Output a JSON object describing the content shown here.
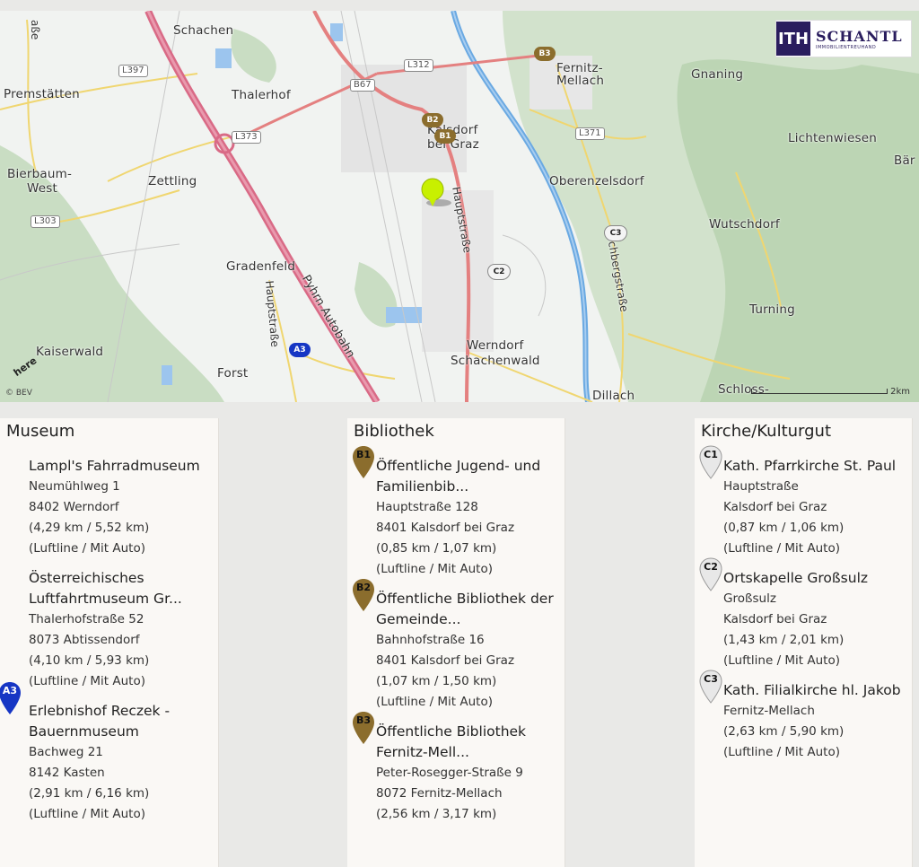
{
  "map": {
    "places": [
      {
        "name": "Schachen"
      },
      {
        "name": "Premstätten"
      },
      {
        "name": "Thalerhof"
      },
      {
        "name": "Fernitz-"
      },
      {
        "name": "Mellach"
      },
      {
        "name": "Gnaning"
      },
      {
        "name": "Kalsdorf"
      },
      {
        "name": "bei Graz"
      },
      {
        "name": "Lichtenwiesen"
      },
      {
        "name": "Bär"
      },
      {
        "name": "Bierbaum-"
      },
      {
        "name": "West"
      },
      {
        "name": "Zettling"
      },
      {
        "name": "Oberenzelsdorf"
      },
      {
        "name": "Wutschdorf"
      },
      {
        "name": "Gradenfeld"
      },
      {
        "name": "Turning"
      },
      {
        "name": "Kaiserwald"
      },
      {
        "name": "Werndorf"
      },
      {
        "name": "Schachenwald"
      },
      {
        "name": "Forst"
      },
      {
        "name": "Dillach"
      },
      {
        "name": "Schloss-"
      }
    ],
    "roads": [
      "L397",
      "L312",
      "B67",
      "L373",
      "L371",
      "L303"
    ],
    "streets": [
      "Hauptstraße",
      "Hauptstraße",
      "Pyhrn Autobahn",
      "Kirchbergstraße",
      "aße"
    ],
    "markers": [
      "B3",
      "B2",
      "B1",
      "C3",
      "C2",
      "A3"
    ],
    "attribution": "© BEV",
    "here": "here",
    "scale": "2km",
    "colors": {
      "autobahn": "#d96a86",
      "main_road": "#e48080",
      "river": "#6aa9e2",
      "forest": "#c9ddc3",
      "marker_b": "#8b6d2d",
      "marker_a": "#1636c4",
      "marker_c": "#e8e8e8",
      "target": "#c8f000"
    }
  },
  "logo": {
    "mark": "ITH",
    "name": "SCHANTL",
    "sub": "IMMOBILIENTREUHAND"
  },
  "columns": [
    {
      "title": "Museum",
      "entries": [
        {
          "marker": "",
          "name": "Lampl's Fahrradmuseum",
          "name2": "",
          "lines": [
            "Neumühlweg 1",
            "8402 Werndorf",
            "(4,29 km / 5,52 km)",
            "(Luftline / Mit Auto)"
          ]
        },
        {
          "marker": "",
          "name": "Österreichisches",
          "name2": "Luftfahrtmuseum Gr...",
          "lines": [
            "Thalerhofstraße 52",
            "8073 Abtissendorf",
            "(4,10 km / 5,93 km)",
            "(Luftline / Mit Auto)"
          ]
        },
        {
          "marker": "A3",
          "name": "Erlebnishof Reczek -",
          "name2": "Bauernmuseum",
          "lines": [
            "Bachweg 21",
            "8142 Kasten",
            "(2,91 km / 6,16 km)",
            "(Luftline / Mit Auto)"
          ]
        }
      ]
    },
    {
      "title": "Bibliothek",
      "entries": [
        {
          "marker": "B1",
          "name": "Öffentliche Jugend- und",
          "name2": "Familienbib...",
          "lines": [
            "Hauptstraße 128",
            "8401 Kalsdorf bei Graz",
            "(0,85 km / 1,07 km)",
            "(Luftline / Mit Auto)"
          ]
        },
        {
          "marker": "B2",
          "name": "Öffentliche Bibliothek der",
          "name2": "Gemeinde...",
          "lines": [
            "Bahnhofstraße 16",
            "8401 Kalsdorf bei Graz",
            "(1,07 km / 1,50 km)",
            "(Luftline / Mit Auto)"
          ]
        },
        {
          "marker": "B3",
          "name": "Öffentliche Bibliothek",
          "name2": "Fernitz-Mell...",
          "lines": [
            "Peter-Rosegger-Straße 9",
            "8072 Fernitz-Mellach",
            "(2,56 km / 3,17 km)"
          ]
        }
      ]
    },
    {
      "title": "Kirche/Kulturgut",
      "entries": [
        {
          "marker": "C1",
          "name": "Kath. Pfarrkirche St. Paul",
          "name2": "",
          "lines": [
            "Hauptstraße",
            "Kalsdorf bei Graz",
            "(0,87 km / 1,06 km)",
            "(Luftline / Mit Auto)"
          ]
        },
        {
          "marker": "C2",
          "name": "Ortskapelle Großsulz",
          "name2": "",
          "lines": [
            "Großsulz",
            "Kalsdorf bei Graz",
            "(1,43 km / 2,01 km)",
            "(Luftline / Mit Auto)"
          ]
        },
        {
          "marker": "C3",
          "name": "Kath. Filialkirche hl. Jakob",
          "name2": "",
          "lines": [
            "Fernitz-Mellach",
            "(2,63 km / 5,90 km)",
            "(Luftline / Mit Auto)"
          ]
        }
      ]
    }
  ]
}
